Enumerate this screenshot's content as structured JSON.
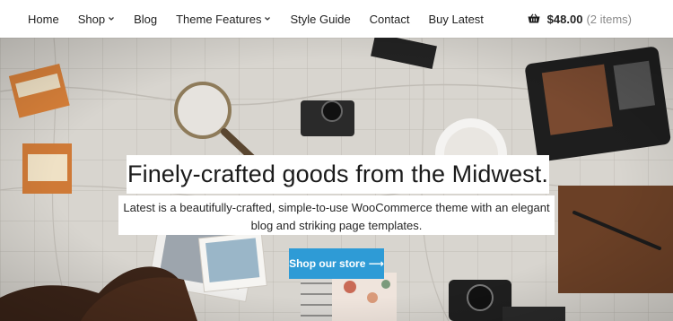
{
  "nav": {
    "items": [
      {
        "label": "Home",
        "has_dropdown": false
      },
      {
        "label": "Shop",
        "has_dropdown": true
      },
      {
        "label": "Blog",
        "has_dropdown": false
      },
      {
        "label": "Theme Features",
        "has_dropdown": true
      },
      {
        "label": "Style Guide",
        "has_dropdown": false
      },
      {
        "label": "Contact",
        "has_dropdown": false
      },
      {
        "label": "Buy Latest",
        "has_dropdown": false
      }
    ]
  },
  "cart": {
    "icon": "basket-icon",
    "total": "$48.00",
    "count": "(2 items)"
  },
  "hero": {
    "headline": "Finely-crafted goods from the Midwest.",
    "subtext": "Latest is a beautifully-crafted, simple-to-use WooCommerce theme with an elegant blog and striking page templates.",
    "cta_label": "Shop our store ⟶"
  },
  "colors": {
    "accent": "#2e9bd6",
    "nav_text": "#1f1f1f",
    "cart_count": "#8a8a8a"
  }
}
